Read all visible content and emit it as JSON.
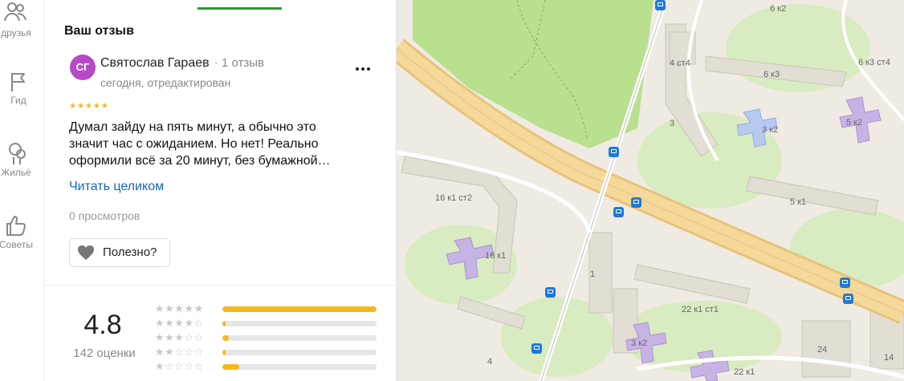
{
  "rail": {
    "items": [
      {
        "label": "друзья",
        "icon": "friends-icon"
      },
      {
        "label": "Гид",
        "icon": "flag-icon"
      },
      {
        "label": "Жильё",
        "icon": "housing-icon"
      },
      {
        "label": "Советы",
        "icon": "thumbs-up-icon"
      }
    ]
  },
  "review": {
    "section_title": "Ваш отзыв",
    "avatar_initials": "СГ",
    "author_name": "Святослав Гараев",
    "author_separator": "·",
    "author_reviews_count": "1 отзыв",
    "date": "сегодня, отредактирован",
    "rating": 5,
    "text": "Думал зайду на пять минут, а обычно это значит час с ожиданием. Но нет! Реально оформили всё за 20 минут, без бумажной…",
    "read_more_label": "Читать целиком",
    "views": "0 просмотров",
    "useful_label": "Полезно?"
  },
  "summary": {
    "rating": "4.8",
    "ratings_count": "142 оценки",
    "distribution": [
      {
        "stars": 5,
        "fraction": 1.0
      },
      {
        "stars": 4,
        "fraction": 0.01
      },
      {
        "stars": 3,
        "fraction": 0.04
      },
      {
        "stars": 2,
        "fraction": 0.01
      },
      {
        "stars": 1,
        "fraction": 0.11
      }
    ]
  },
  "map": {
    "labels": [
      "6 к2",
      "4 ст4",
      "6 к3",
      "6 к3 ст4",
      "3 к2",
      "5 к2",
      "3",
      "16 к1 ст2",
      "5 к1",
      "16 к1",
      "1",
      "22 к1 ст1",
      "3 к2",
      "4",
      "24",
      "14",
      "22 к1"
    ]
  },
  "colors": {
    "accent_green": "#2d9a2a",
    "link_blue": "#1565c0",
    "star_yellow": "#f6b819",
    "avatar": "#b54ac6",
    "bus_stop": "#1e7ad6"
  }
}
